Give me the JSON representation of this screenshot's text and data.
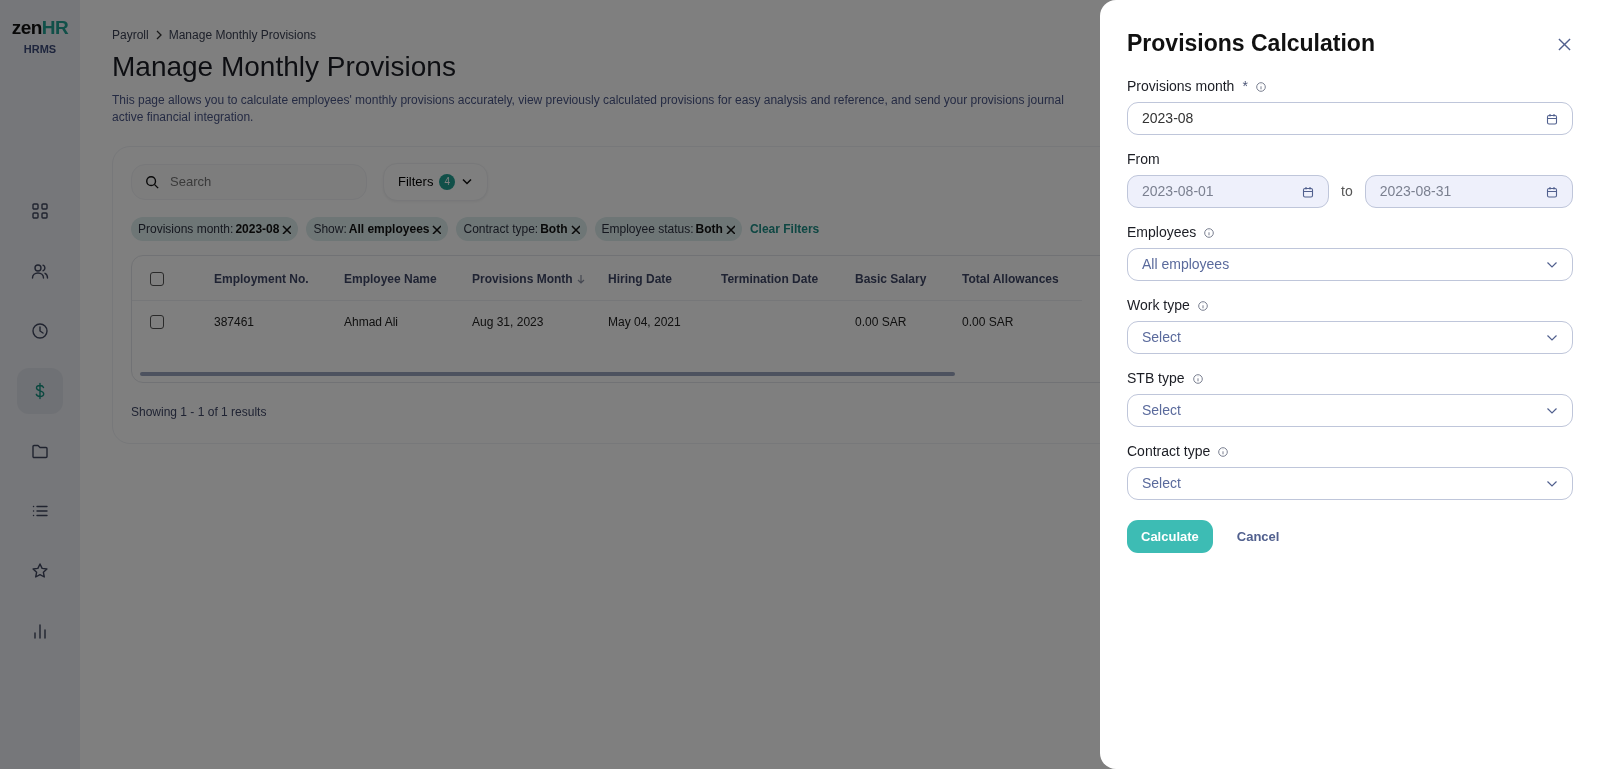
{
  "logo": {
    "word": "zen",
    "accent": "HR",
    "subtitle": "HRMS"
  },
  "sidebar": {
    "items": [
      {
        "selected": false
      },
      {
        "selected": false
      },
      {
        "selected": false
      },
      {
        "selected": true
      },
      {
        "selected": false
      },
      {
        "selected": false
      },
      {
        "selected": false
      },
      {
        "selected": false
      }
    ]
  },
  "breadcrumb": [
    "Payroll",
    "Manage Monthly Provisions"
  ],
  "page": {
    "title": "Manage Monthly Provisions",
    "description": "This page allows you to calculate employees' monthly provisions accurately, view previously calculated provisions for easy analysis and reference, and send your provisions journal",
    "description_2": "active financial integration."
  },
  "search": {
    "placeholder": "Search"
  },
  "filters_button": {
    "label": "Filters",
    "count": "4"
  },
  "active_filters": [
    {
      "label": "Provisions month:",
      "value": "2023-08"
    },
    {
      "label": "Show:",
      "value": "All employees"
    },
    {
      "label": "Contract type:",
      "value": "Both"
    },
    {
      "label": "Employee status:",
      "value": "Both"
    }
  ],
  "clear_filters": "Clear Filters",
  "table": {
    "select_all": {
      "checked": false
    },
    "columns": [
      {
        "label": "Employment No.",
        "sorted": false
      },
      {
        "label": "Employee Name",
        "sorted": false
      },
      {
        "label": "Provisions Month",
        "sorted": true
      },
      {
        "label": "Hiring Date",
        "sorted": false
      },
      {
        "label": "Termination Date",
        "sorted": false
      },
      {
        "label": "Basic Salary",
        "sorted": false
      },
      {
        "label": "Total Allowances",
        "sorted": false
      }
    ],
    "rows": [
      {
        "checked": false,
        "cells": [
          "387461",
          "Ahmad Ali",
          "Aug 31, 2023",
          "May 04, 2021",
          null,
          "0.00 SAR",
          "0.00 SAR"
        ]
      }
    ]
  },
  "results_text": "Showing 1 - 1 of 1 results",
  "drawer": {
    "title": "Provisions Calculation",
    "fields": [
      {
        "kind": "month",
        "label": "Provisions month",
        "required": "*",
        "info": true,
        "value": "2023-08"
      },
      {
        "kind": "range",
        "label": "From",
        "info": false,
        "from": "2023-08-01",
        "separator": "to",
        "to": "2023-08-31",
        "disabled": true
      },
      {
        "kind": "select",
        "label": "Employees",
        "info": true,
        "value": "All employees"
      },
      {
        "kind": "select",
        "label": "Work type",
        "info": true,
        "placeholder": "Select"
      },
      {
        "kind": "select",
        "label": "STB type",
        "info": true,
        "placeholder": "Select"
      },
      {
        "kind": "select",
        "label": "Contract type",
        "info": true,
        "placeholder": "Select"
      }
    ],
    "primary_button": "Calculate",
    "secondary_button": "Cancel"
  }
}
